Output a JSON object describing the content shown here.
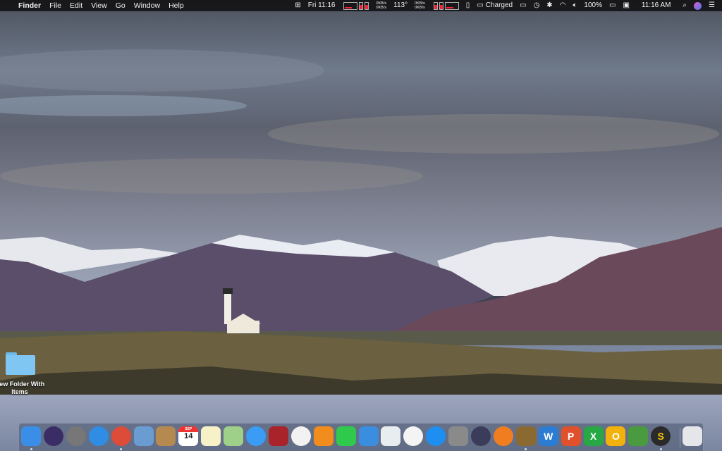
{
  "menubar": {
    "app": "Finder",
    "menus": [
      "File",
      "Edit",
      "View",
      "Go",
      "Window",
      "Help"
    ],
    "clock_short": "Fri 11:16",
    "net_up": "0KB/s",
    "net_down": "0KB/s",
    "temperature": "113°",
    "net2_up": "0KB/s",
    "net2_down": "0KB/s",
    "battery_status": "Charged",
    "battery_percent": "100%",
    "clock": "11:16 AM"
  },
  "desktop": {
    "items": [
      {
        "label": "New Folder With Items",
        "icon": "folder-icon"
      }
    ]
  },
  "dock": {
    "items": [
      {
        "name": "finder",
        "running": true,
        "color": "#3b8ee8"
      },
      {
        "name": "siri",
        "running": false,
        "color": "#3a2d66"
      },
      {
        "name": "launchpad",
        "running": false,
        "color": "#777"
      },
      {
        "name": "safari",
        "running": false,
        "color": "#2f8de4"
      },
      {
        "name": "chrome",
        "running": true,
        "color": "#dd4b39"
      },
      {
        "name": "preview",
        "running": false,
        "color": "#6a9bd1"
      },
      {
        "name": "contacts",
        "running": false,
        "color": "#b58a50"
      },
      {
        "name": "calendar",
        "running": false,
        "color": "#ffffff",
        "label": "14",
        "sub": "SEP"
      },
      {
        "name": "notes",
        "running": false,
        "color": "#f7f1c8"
      },
      {
        "name": "maps",
        "running": false,
        "color": "#9fd08a"
      },
      {
        "name": "messages",
        "running": false,
        "color": "#3a9cf5"
      },
      {
        "name": "photo-booth",
        "running": false,
        "color": "#a8242a"
      },
      {
        "name": "photos",
        "running": false,
        "color": "#f2f2f2"
      },
      {
        "name": "pages",
        "running": false,
        "color": "#f28c1c"
      },
      {
        "name": "facetime",
        "running": false,
        "color": "#2fc94c"
      },
      {
        "name": "keynote",
        "running": false,
        "color": "#3b8de0"
      },
      {
        "name": "numbers",
        "running": false,
        "color": "#e8eef0"
      },
      {
        "name": "itunes",
        "running": false,
        "color": "#f4f4f4"
      },
      {
        "name": "app-store",
        "running": false,
        "color": "#1e8ef0"
      },
      {
        "name": "system-preferences",
        "running": false,
        "color": "#8a8a8a"
      },
      {
        "name": "speed-gauge",
        "running": false,
        "color": "#3b3b5a"
      },
      {
        "name": "books",
        "running": false,
        "color": "#f07e20"
      },
      {
        "name": "window-app",
        "running": true,
        "color": "#8a6a30"
      },
      {
        "name": "word",
        "running": false,
        "color": "#2b7cd3",
        "label": "W"
      },
      {
        "name": "powerpoint",
        "running": false,
        "color": "#e0502a",
        "label": "P"
      },
      {
        "name": "excel",
        "running": false,
        "color": "#27a844",
        "label": "X"
      },
      {
        "name": "outlook",
        "running": false,
        "color": "#f2b10d",
        "label": "O"
      },
      {
        "name": "downloader",
        "running": false,
        "color": "#4a9a40"
      },
      {
        "name": "scrivener",
        "running": true,
        "color": "#2a2a2a",
        "label": "S"
      }
    ],
    "trash": {
      "name": "trash",
      "color": "#e4e6ea"
    }
  }
}
